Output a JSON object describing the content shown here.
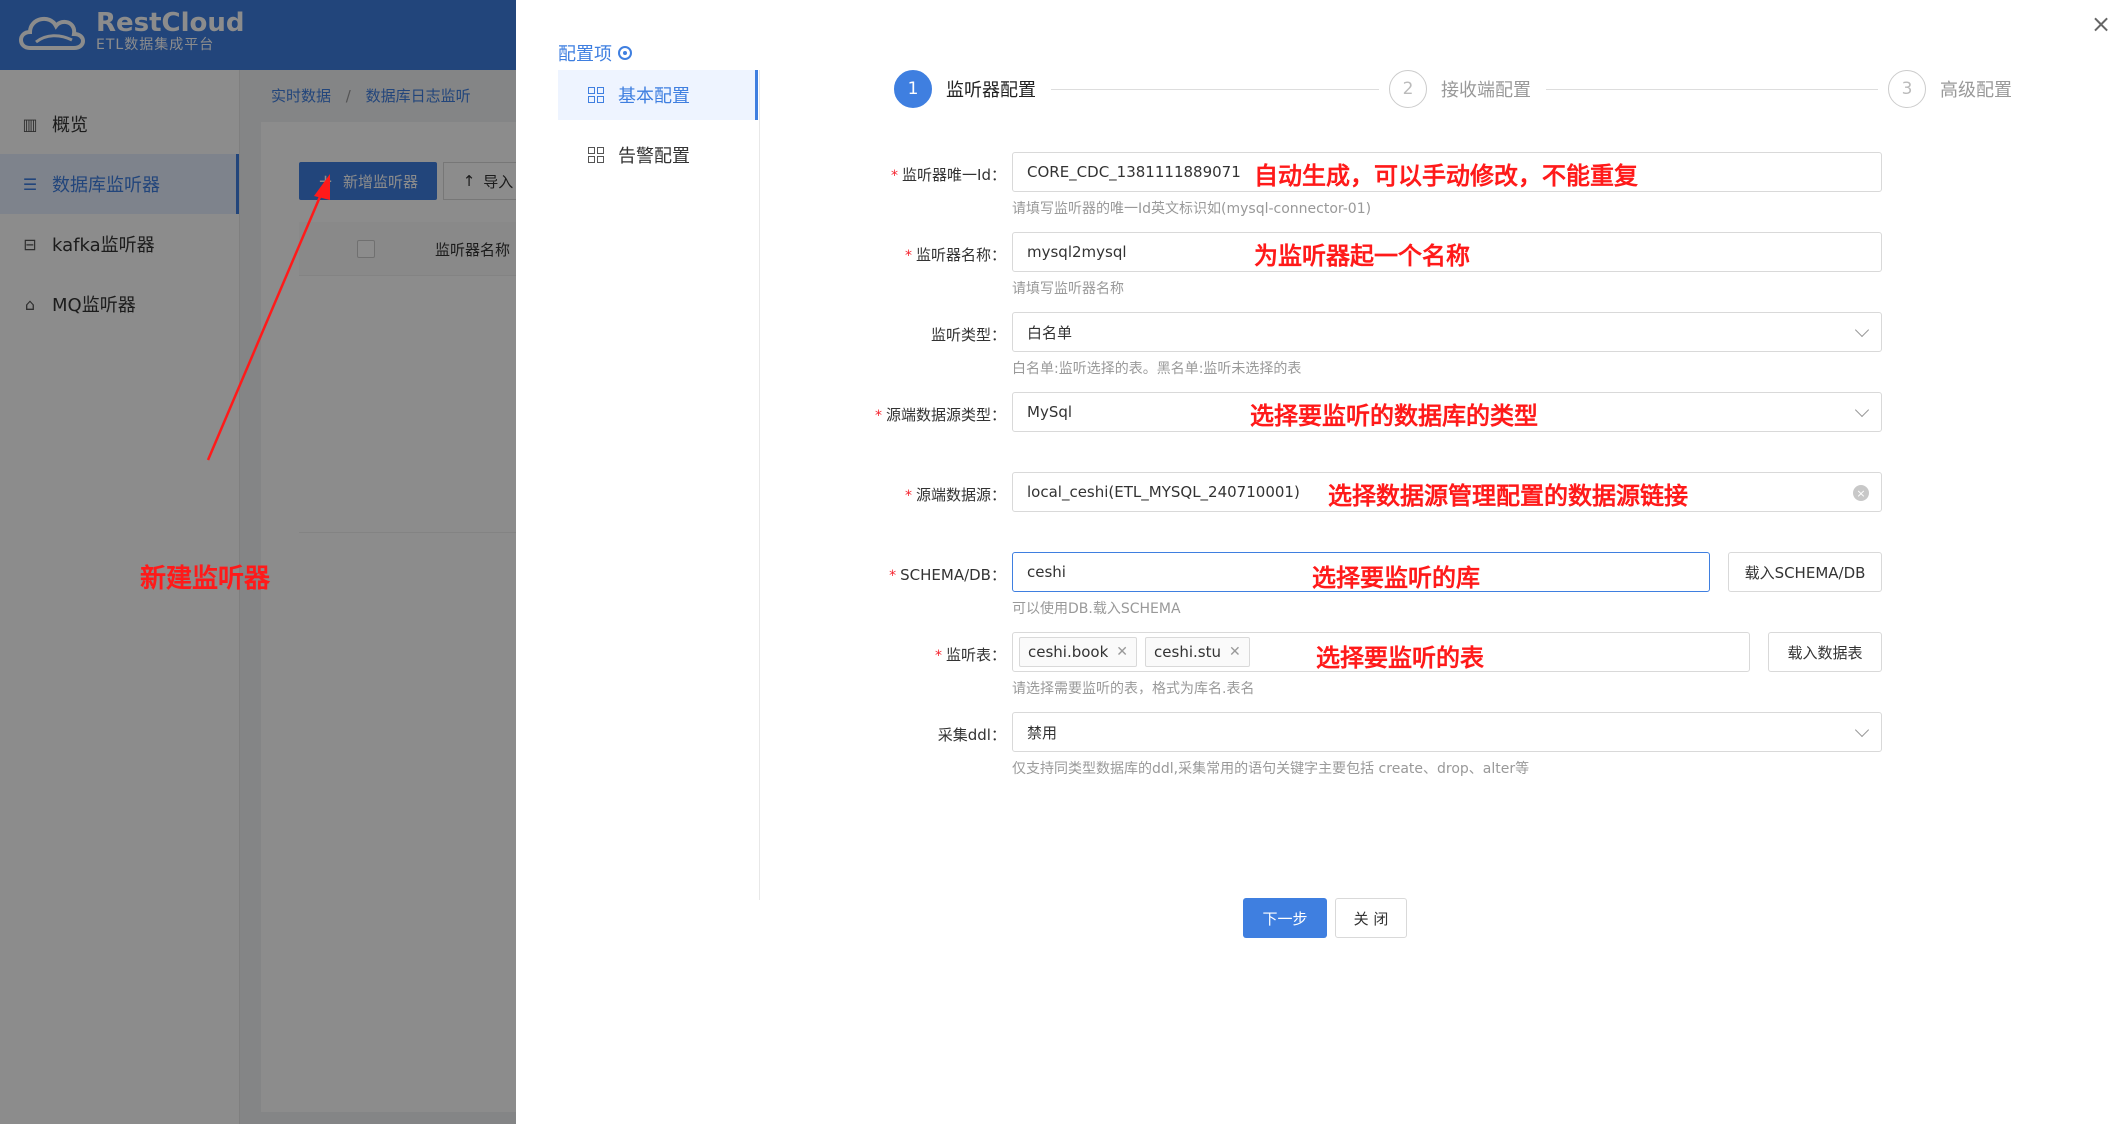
{
  "app": {
    "logo_title": "RestCloud",
    "logo_sub": "ETL数据集成平台"
  },
  "sidebar": {
    "items": [
      {
        "label": "概览",
        "icon": "chart-icon"
      },
      {
        "label": "数据库监听器",
        "icon": "list-icon",
        "active": true
      },
      {
        "label": "kafka监听器",
        "icon": "kafka-icon"
      },
      {
        "label": "MQ监听器",
        "icon": "mq-icon"
      }
    ]
  },
  "breadcrumb": {
    "items": [
      "实时数据",
      "数据库日志监听"
    ],
    "separator": "/"
  },
  "toolbar": {
    "new_label": "新增监听器",
    "import_label": "导入"
  },
  "table": {
    "columns": [
      "监听器名称"
    ]
  },
  "annotations": {
    "new_listener": "新建监听器",
    "listener_id": "自动生成，可以手动修改，不能重复",
    "listener_name": "为监听器起一个名称",
    "source_type": "选择要监听的数据库的类型",
    "datasource": "选择数据源管理配置的数据源链接",
    "schema": "选择要监听的库",
    "tables": "选择要监听的表"
  },
  "drawer": {
    "config_title": "配置项",
    "menu": [
      {
        "label": "基本配置",
        "active": true
      },
      {
        "label": "告警配置"
      }
    ],
    "steps": [
      {
        "num": "1",
        "label": "监听器配置",
        "active": true
      },
      {
        "num": "2",
        "label": "接收端配置"
      },
      {
        "num": "3",
        "label": "高级配置"
      }
    ],
    "form": {
      "listener_id": {
        "label": "监听器唯一Id",
        "value": "CORE_CDC_1381111889071",
        "hint": "请填写监听器的唯一Id英文标识如(mysql-connector-01)"
      },
      "listener_name": {
        "label": "监听器名称",
        "value": "mysql2mysql",
        "hint": "请填写监听器名称"
      },
      "listen_type": {
        "label": "监听类型",
        "value": "白名单",
        "hint": "白名单:监听选择的表。黑名单:监听未选择的表"
      },
      "source_type": {
        "label": "源端数据源类型",
        "value": "MySql"
      },
      "datasource": {
        "label": "源端数据源",
        "value": "local_ceshi(ETL_MYSQL_240710001)"
      },
      "schema": {
        "label": "SCHEMA/DB",
        "value": "ceshi",
        "hint": "可以使用DB.载入SCHEMA",
        "button": "载入SCHEMA/DB"
      },
      "tables": {
        "label": "监听表",
        "tags": [
          "ceshi.book",
          "ceshi.stu"
        ],
        "hint": "请选择需要监听的表，格式为库名.表名",
        "button": "载入数据表"
      },
      "ddl": {
        "label": "采集ddl",
        "value": "禁用",
        "hint": "仅支持同类型数据库的ddl,采集常用的语句关键字主要包括 create、drop、alter等"
      }
    },
    "next_label": "下一步",
    "close_label": "关 闭"
  },
  "colors": {
    "primary": "#3f7fe0",
    "annotation": "#ff1a1a",
    "required": "#f5222d"
  }
}
